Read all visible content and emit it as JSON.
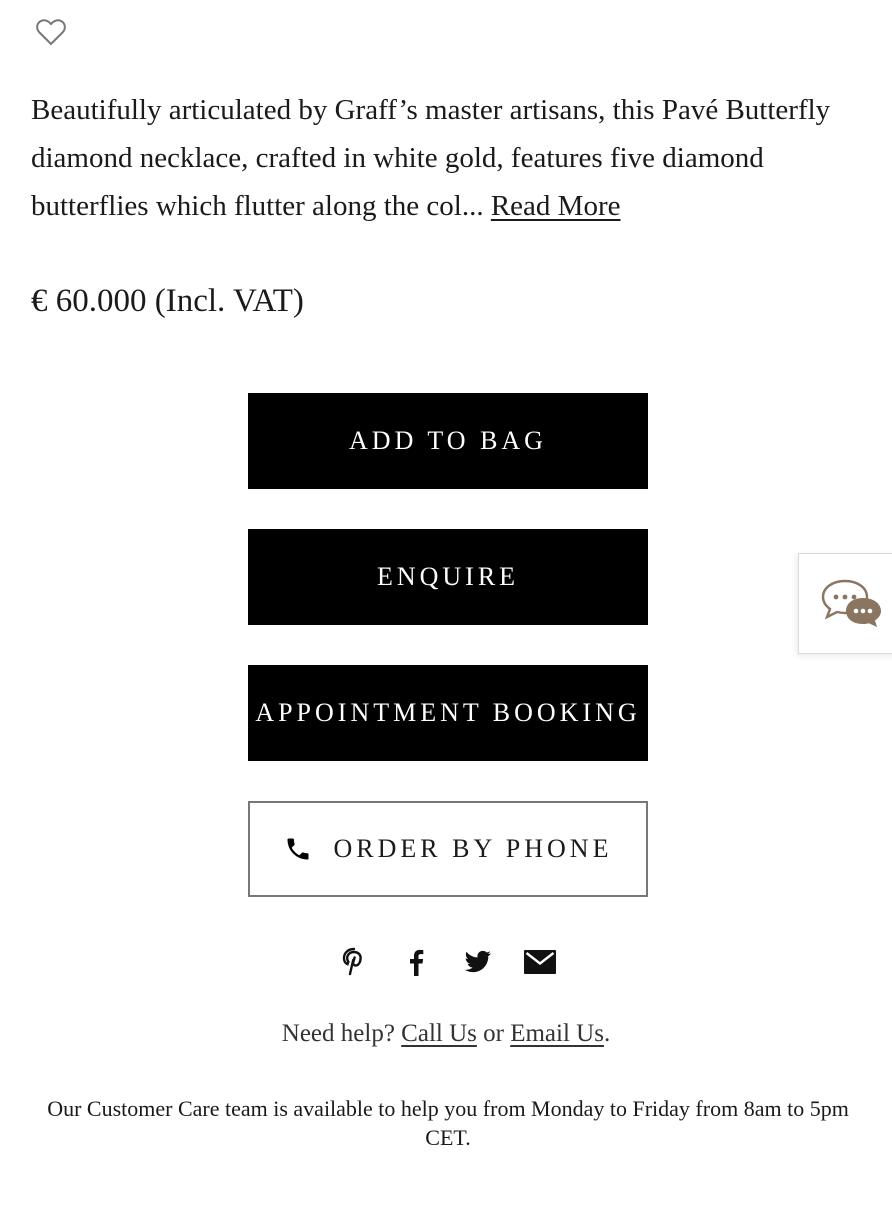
{
  "product": {
    "description": "Beautifully articulated by Graff’s master artisans, this Pavé Butterfly diamond necklace, crafted in white gold, features five diamond butterflies which flutter along the col...",
    "read_more_label": "Read More",
    "price": "€ 60.000 (Incl. VAT)",
    "wishlist_icon": "heart-outline-icon"
  },
  "actions": {
    "add_to_bag": "ADD TO BAG",
    "enquire": "ENQUIRE",
    "appointment": "APPOINTMENT BOOKING",
    "order_by_phone": "ORDER BY PHONE",
    "phone_icon": "phone-icon"
  },
  "chat": {
    "icon": "chat-bubbles-icon",
    "accent_color": "#8a7560"
  },
  "share": {
    "icons": [
      "pinterest-icon",
      "facebook-icon",
      "twitter-icon",
      "email-icon"
    ]
  },
  "help": {
    "prefix": "Need help?",
    "call_us": "Call Us",
    "or": "or",
    "email_us": "Email Us",
    "suffix": "."
  },
  "customer_care": {
    "text": "Our Customer Care team is available to help you from Monday to Friday from 8am to 5pm CET."
  }
}
